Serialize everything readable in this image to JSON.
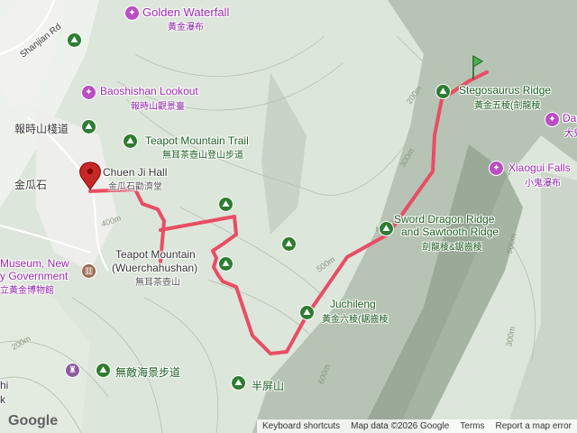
{
  "map": {
    "colors": {
      "route": "#e94d64",
      "poi": "#b94fc2",
      "hiking": "#2e7d32",
      "museum": "#9c6b4e"
    },
    "places": {
      "golden_waterfall": {
        "en": "Golden Waterfall",
        "zh": "黃金瀑布"
      },
      "shanjian_rd": "Shanjian Rd",
      "baoshishan": {
        "en": "Baoshishan Lookout",
        "zh": "報時山觀景臺"
      },
      "baoshishan_trail_zh": "報時山棧道",
      "teapot_trail": {
        "en": "Teapot Mountain Trail",
        "zh": "無耳茶壺山登山步道"
      },
      "chuen_ji_hall": {
        "en": "Chuen Ji Hall",
        "zh": "金瓜石勸濟堂"
      },
      "jinguashi": "金瓜石",
      "teapot_mountain": {
        "en1": "Teapot Mountain",
        "en2": "(Wuerchahushan)",
        "zh": "無耳茶壺山"
      },
      "museum": {
        "en1": "Museum, New",
        "en2": "y Government",
        "zh": "立黃金博物館"
      },
      "wudi_trail_zh": "無敵海景步道",
      "banpingshan_zh": "半屏山",
      "stegosaurus": {
        "en": "Stegosaurus Ridge",
        "zh": "黃金五稜(劍龍稜"
      },
      "dagui": {
        "en": "Dagui W",
        "zh": "大兒"
      },
      "xiaogui": {
        "en": "Xiaogui Falls",
        "zh": "小鬼瀑布"
      },
      "sword_dragon": {
        "en1": "Sword Dragon Ridge",
        "en2": "and Sawtooth Ridge",
        "zh": "劍龍稜&鋸齒稜"
      },
      "juchileng": {
        "en": "Juchileng",
        "zh": "黃金六稜(鋸齒稜"
      },
      "edge_left": "hi",
      "edge_left2": "k"
    },
    "contours": [
      "200m",
      "300m",
      "400m",
      "500m",
      "600m",
      "400m",
      "200m",
      "300m",
      "500m"
    ],
    "footer": {
      "logo": "Google",
      "shortcuts": "Keyboard shortcuts",
      "map_data": "Map data ©2026 Google",
      "terms": "Terms",
      "report": "Report a map error"
    }
  }
}
